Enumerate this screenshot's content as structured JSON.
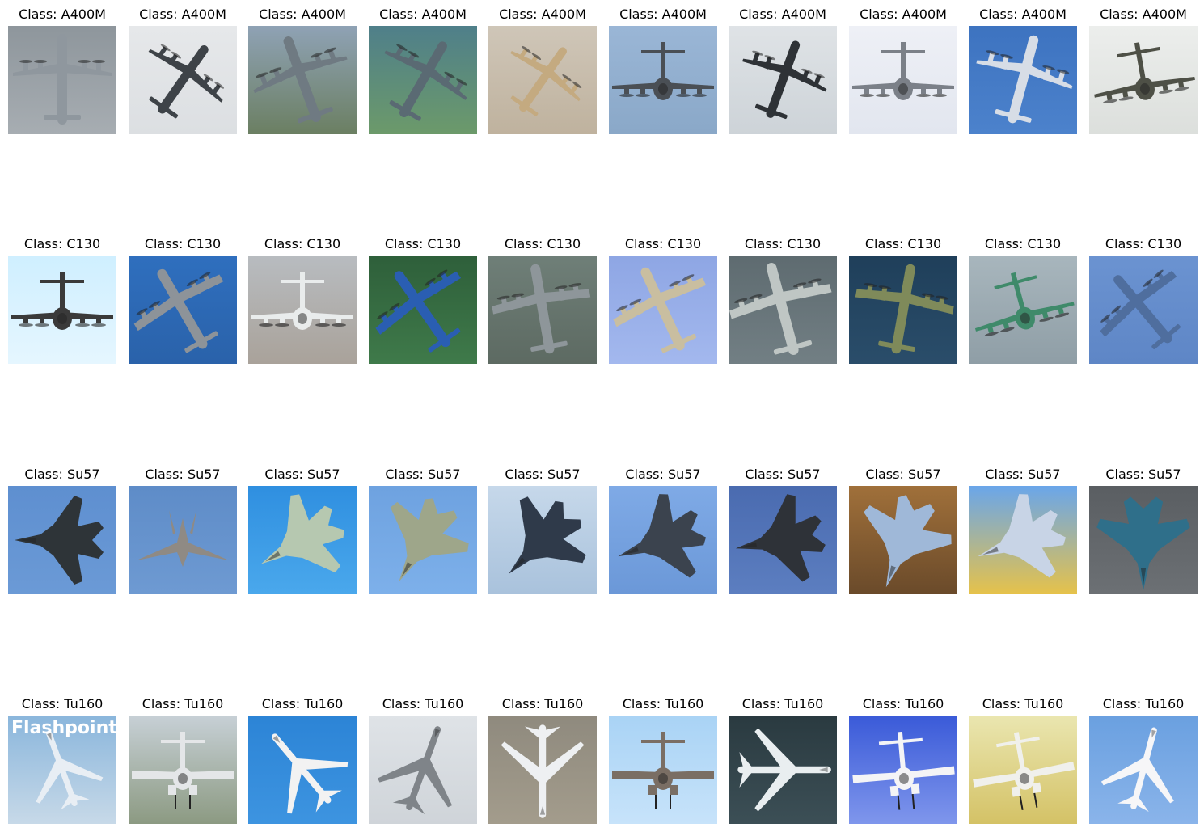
{
  "figure": {
    "rows": [
      {
        "class_label": "Class: A400M",
        "aircraft": "a400m",
        "images": [
          {
            "bg": [
              "#8e969c",
              "#a7adb2"
            ],
            "plane": "#8f979e",
            "view": "top",
            "rot": 0,
            "scale": 1.0
          },
          {
            "bg": [
              "#e6e8ea",
              "#dcdfe2"
            ],
            "plane": "#3e4348",
            "view": "top",
            "rot": 35,
            "scale": 0.9
          },
          {
            "bg": [
              "#8fa2b5",
              "#6b7f62"
            ],
            "plane": "#6f7a82",
            "view": "top",
            "rot": -20,
            "scale": 1.0
          },
          {
            "bg": [
              "#4f7f8a",
              "#6c9a6a"
            ],
            "plane": "#5a6a73",
            "view": "top",
            "rot": 30,
            "scale": 0.95
          },
          {
            "bg": [
              "#cfc6b8",
              "#bfb29e"
            ],
            "plane": "#c4aa80",
            "view": "top",
            "rot": 35,
            "scale": 0.85
          },
          {
            "bg": [
              "#9ab6d6",
              "#8aa8c8"
            ],
            "plane": "#4a4f55",
            "view": "front",
            "rot": 0,
            "scale": 1.0
          },
          {
            "bg": [
              "#dfe3e6",
              "#cdd3d8"
            ],
            "plane": "#2e3236",
            "view": "top",
            "rot": 20,
            "scale": 0.9
          },
          {
            "bg": [
              "#eef0f6",
              "#e2e6ef"
            ],
            "plane": "#7b8088",
            "view": "front",
            "rot": 0,
            "scale": 1.0
          },
          {
            "bg": [
              "#3d73c0",
              "#4c82cc"
            ],
            "plane": "#d7dde6",
            "view": "top",
            "rot": 15,
            "scale": 1.0
          },
          {
            "bg": [
              "#eceeec",
              "#dcdfdc"
            ],
            "plane": "#4e5046",
            "view": "front",
            "rot": -10,
            "scale": 1.0
          }
        ]
      },
      {
        "class_label": "Class: C130",
        "aircraft": "c130",
        "images": [
          {
            "bg": [
              "#cfefff",
              "#e5f6ff"
            ],
            "plane": "#3a3a3a",
            "view": "front",
            "rot": 0,
            "scale": 1.0
          },
          {
            "bg": [
              "#2f6fbe",
              "#2a62aa"
            ],
            "plane": "#8d9399",
            "view": "top",
            "rot": -30,
            "scale": 1.0
          },
          {
            "bg": [
              "#b8bcc0",
              "#a9a29a"
            ],
            "plane": "#e9ecec",
            "view": "front",
            "rot": 0,
            "scale": 1.0
          },
          {
            "bg": [
              "#2e5f3a",
              "#3f7a4a"
            ],
            "plane": "#2a5eb2",
            "view": "top",
            "rot": -35,
            "scale": 1.0
          },
          {
            "bg": [
              "#6f7f78",
              "#5d6a62"
            ],
            "plane": "#8e969a",
            "view": "top",
            "rot": -10,
            "scale": 1.0
          },
          {
            "bg": [
              "#8ea6e4",
              "#a3b8ee"
            ],
            "plane": "#c9bea0",
            "view": "top",
            "rot": -25,
            "scale": 1.0
          },
          {
            "bg": [
              "#5e6b70",
              "#727f84"
            ],
            "plane": "#bfc6c4",
            "view": "top",
            "rot": -15,
            "scale": 1.05
          },
          {
            "bg": [
              "#1f3f5a",
              "#2a4d6a"
            ],
            "plane": "#7f8a5a",
            "view": "top",
            "rot": 10,
            "scale": 1.0
          },
          {
            "bg": [
              "#a8b6bd",
              "#8f9ea6"
            ],
            "plane": "#3f8a6a",
            "view": "front",
            "rot": -15,
            "scale": 1.0
          },
          {
            "bg": [
              "#6b93d1",
              "#5e86c6"
            ],
            "plane": "#4f6e9e",
            "view": "top",
            "rot": -40,
            "scale": 0.95
          }
        ]
      },
      {
        "class_label": "Class: Su57",
        "aircraft": "su57",
        "images": [
          {
            "bg": [
              "#5e8fd0",
              "#6b9ad6"
            ],
            "plane": "#2e3438",
            "view": "top",
            "rot": -90,
            "scale": 1.0
          },
          {
            "bg": [
              "#5e8cc8",
              "#6e9ad2"
            ],
            "plane": "#8f8a84",
            "view": "front",
            "rot": 0,
            "scale": 1.0
          },
          {
            "bg": [
              "#2f8fe0",
              "#4aa8ec"
            ],
            "plane": "#b6c8b0",
            "view": "top",
            "rot": -120,
            "scale": 1.0
          },
          {
            "bg": [
              "#6ea2e0",
              "#7db0ea"
            ],
            "plane": "#9ea68a",
            "view": "top",
            "rot": -150,
            "scale": 1.0
          },
          {
            "bg": [
              "#c6d8ea",
              "#a9c2dc"
            ],
            "plane": "#2f3a4a",
            "view": "top",
            "rot": -135,
            "scale": 1.0
          },
          {
            "bg": [
              "#7faae6",
              "#6b98d8"
            ],
            "plane": "#3b434e",
            "view": "top",
            "rot": -110,
            "scale": 1.0
          },
          {
            "bg": [
              "#4a6bb0",
              "#5c7ec0"
            ],
            "plane": "#2e3238",
            "view": "top",
            "rot": -100,
            "scale": 1.0
          },
          {
            "bg": [
              "#a0703a",
              "#6a4a2a"
            ],
            "plane": "#9fb8d8",
            "view": "top",
            "rot": -160,
            "scale": 1.05
          },
          {
            "bg": [
              "#6aa6ea",
              "#e6c24a"
            ],
            "plane": "#c8d4e6",
            "view": "top",
            "rot": -110,
            "scale": 1.0
          },
          {
            "bg": [
              "#5a5e62",
              "#6c7074"
            ],
            "plane": "#2f6f8a",
            "view": "top",
            "rot": 180,
            "scale": 1.05
          }
        ]
      },
      {
        "class_label": "Class: Tu160",
        "aircraft": "tu160",
        "images": [
          {
            "bg": [
              "#8ab6dc",
              "#c7d9e8"
            ],
            "plane": "#e8eef4",
            "view": "top",
            "rot": -20,
            "scale": 0.9,
            "cover_title": "Flashpoint"
          },
          {
            "bg": [
              "#c7d0d6",
              "#8c9a82"
            ],
            "plane": "#e4e6e8",
            "view": "front",
            "rot": 0,
            "scale": 1.0
          },
          {
            "bg": [
              "#2c84d6",
              "#3d94e0"
            ],
            "plane": "#f2f2f2",
            "view": "top",
            "rot": -40,
            "scale": 1.0
          },
          {
            "bg": [
              "#dfe3e7",
              "#cfd4d9"
            ],
            "plane": "#7f8489",
            "view": "top",
            "rot": 20,
            "scale": 1.0
          },
          {
            "bg": [
              "#8f8a7e",
              "#a39c8c"
            ],
            "plane": "#eef0f2",
            "view": "top",
            "rot": 180,
            "scale": 1.05
          },
          {
            "bg": [
              "#a9d3f5",
              "#c7e3fa"
            ],
            "plane": "#7a6e64",
            "view": "front",
            "rot": 0,
            "scale": 1.0
          },
          {
            "bg": [
              "#2a3a40",
              "#3c4f56"
            ],
            "plane": "#e9eef0",
            "view": "top",
            "rot": 90,
            "scale": 1.05
          },
          {
            "bg": [
              "#3a5ad8",
              "#7f96ec"
            ],
            "plane": "#f4f4f6",
            "view": "front",
            "rot": -5,
            "scale": 1.0
          },
          {
            "bg": [
              "#eae6b0",
              "#d4c266"
            ],
            "plane": "#f0f0ec",
            "view": "front",
            "rot": -10,
            "scale": 1.0
          },
          {
            "bg": [
              "#6aa0e0",
              "#8ab4ea"
            ],
            "plane": "#f6f6f8",
            "view": "top",
            "rot": 15,
            "scale": 0.95
          }
        ]
      }
    ]
  }
}
